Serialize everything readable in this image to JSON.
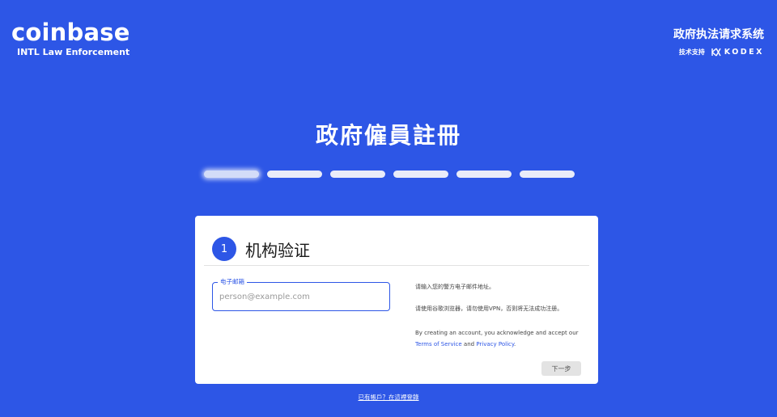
{
  "brand": {
    "logo": "coinbase",
    "subtitle": "INTL Law Enforcement"
  },
  "system": {
    "title": "政府执法请求系统",
    "tech_support": "技术支持",
    "partner_name": "KODEX",
    "partner_icon": "kodex-logo-icon"
  },
  "page": {
    "title": "政府僱員註冊"
  },
  "steps": {
    "total": 6,
    "current": 1
  },
  "card": {
    "step_number": "1",
    "title": "机构验证",
    "email_field": {
      "label": "电子邮箱",
      "placeholder": "person@example.com",
      "value": ""
    },
    "info": {
      "line1": "请输入您的警方电子邮件地址。",
      "line2": "请使用谷歌浏览器，请勿使用VPN，否则将无法成功注册。",
      "consent_prefix": "By creating an account, you acknowledge and accept our",
      "terms_link": "Terms of Service",
      "and_text": "and",
      "privacy_link": "Privacy Policy",
      "period": "."
    },
    "next_button": "下一步"
  },
  "footer": {
    "login_link": "已有帳戶？在這裡登錄"
  },
  "colors": {
    "background": "#2d56e6",
    "accent": "#2d56e6",
    "card": "#ffffff"
  }
}
